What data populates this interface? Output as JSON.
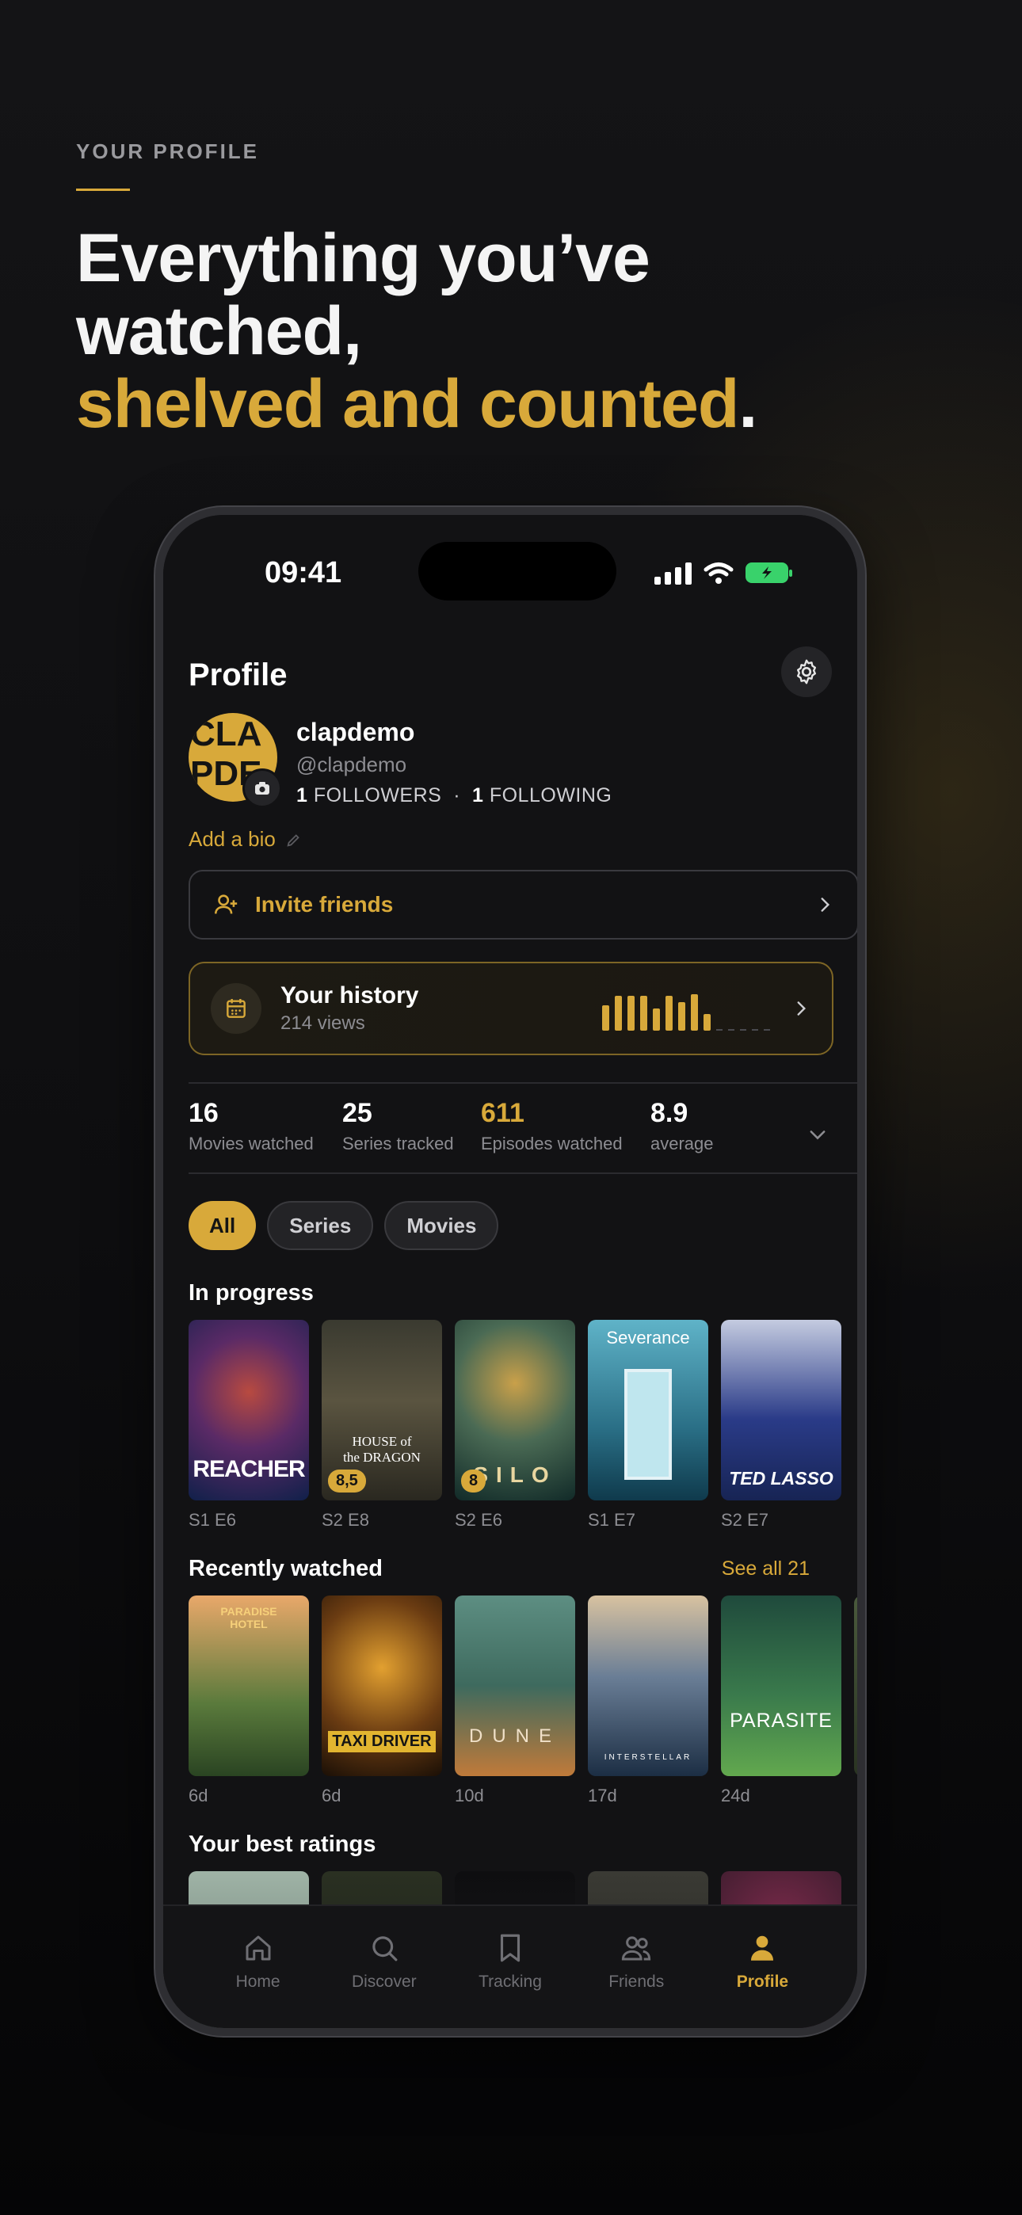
{
  "hero": {
    "eyebrow": "YOUR PROFILE",
    "line1": "Everything you’ve",
    "line2": "watched,",
    "accent": "shelved and counted",
    "period": "."
  },
  "status": {
    "time": "09:41"
  },
  "profile": {
    "title": "Profile",
    "avatar_line1": "CLA",
    "avatar_line2": "PDE",
    "username": "clapdemo",
    "handle": "@clapdemo",
    "followers_count": "1",
    "followers_label": "FOLLOWERS",
    "separator": "·",
    "following_count": "1",
    "following_label": "FOLLOWING",
    "bio_link": "Add a bio"
  },
  "invite": {
    "label": "Invite friends"
  },
  "history": {
    "title": "Your history",
    "subtitle": "214 views",
    "bars": [
      0.58,
      0.78,
      0.78,
      0.78,
      0.5,
      0.78,
      0.64,
      0.82,
      0.38
    ]
  },
  "stats": [
    {
      "value": "16",
      "caption": "Movies watched",
      "gold": false
    },
    {
      "value": "25",
      "caption": "Series tracked",
      "gold": false
    },
    {
      "value": "611",
      "caption": "Episodes watched",
      "gold": true
    },
    {
      "value": "8.9",
      "caption": "average",
      "gold": false
    }
  ],
  "filters": [
    "All",
    "Series",
    "Movies"
  ],
  "in_progress": {
    "title": "In progress",
    "items": [
      {
        "poster_text": "REACHER",
        "meta": "S1 E6",
        "rating": ""
      },
      {
        "poster_text": "HOUSE of the DRAGON",
        "meta": "S2 E8",
        "rating": "8,5"
      },
      {
        "poster_text": "SILO",
        "meta": "S2 E6",
        "rating": "8"
      },
      {
        "poster_text": "Severance",
        "meta": "S1 E7",
        "rating": ""
      },
      {
        "poster_text": "TED LASSO",
        "meta": "S2 E7",
        "rating": ""
      }
    ]
  },
  "recently_watched": {
    "title": "Recently watched",
    "see_all": "See all 21",
    "items": [
      {
        "poster_text": "PARADISE HOTEL",
        "meta": "6d"
      },
      {
        "poster_text": "TAXI DRIVER",
        "meta": "6d"
      },
      {
        "poster_text": "DUNE",
        "meta": "10d"
      },
      {
        "poster_text": "INTERSTELLAR",
        "meta": "17d"
      },
      {
        "poster_text": "PARASITE",
        "meta": "24d"
      }
    ]
  },
  "best_ratings": {
    "title": "Your best ratings"
  },
  "tabs": [
    {
      "label": "Home",
      "icon": "home-icon",
      "active": false
    },
    {
      "label": "Discover",
      "icon": "search-icon",
      "active": false
    },
    {
      "label": "Tracking",
      "icon": "bookmark-icon",
      "active": false
    },
    {
      "label": "Friends",
      "icon": "friends-icon",
      "active": false
    },
    {
      "label": "Profile",
      "icon": "profile-icon",
      "active": true
    }
  ],
  "colors": {
    "accent": "#d8a93a",
    "background": "#121214"
  }
}
